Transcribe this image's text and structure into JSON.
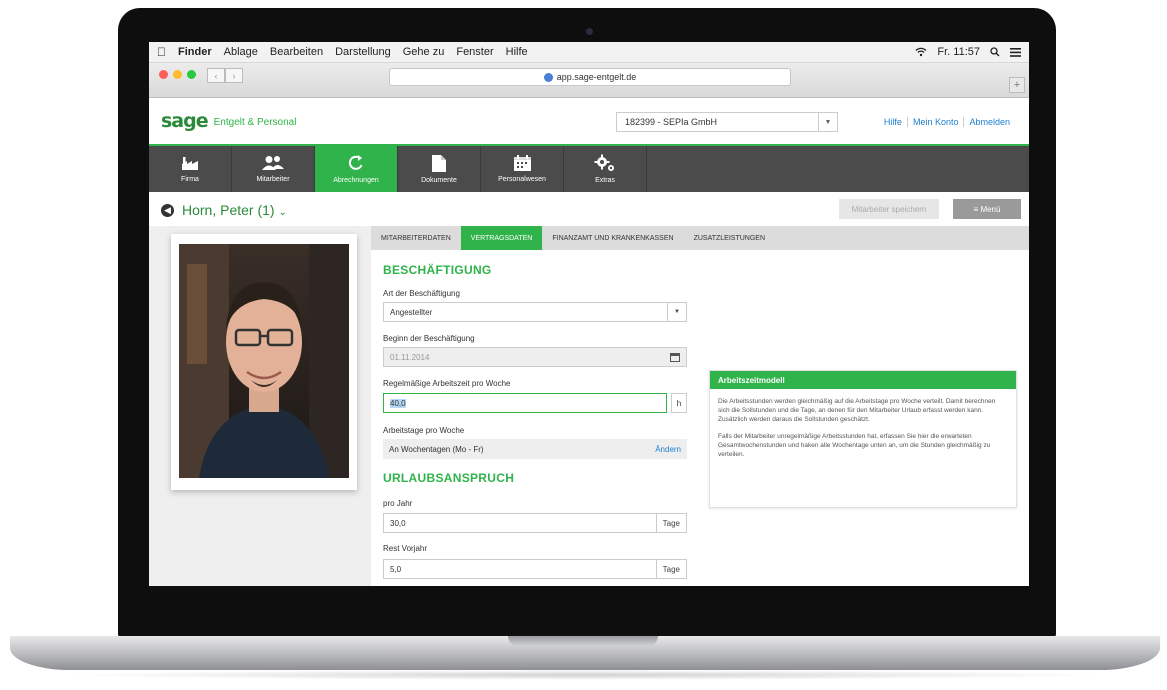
{
  "menubar": {
    "items": [
      "Finder",
      "Ablage",
      "Bearbeiten",
      "Darstellung",
      "Gehe zu",
      "Fenster",
      "Hilfe"
    ],
    "clock": "Fr. 11:57"
  },
  "browser": {
    "url": "app.sage-entgelt.de"
  },
  "header": {
    "logo": "sage",
    "product": "Entgelt & Personal",
    "company": "182399 - SEPIa GmbH",
    "links": [
      "Hilfe",
      "Mein Konto",
      "Abmelden"
    ]
  },
  "nav": {
    "tiles": [
      {
        "label": "Firma",
        "icon": "factory-icon"
      },
      {
        "label": "Mitarbeiter",
        "icon": "people-icon"
      },
      {
        "label": "Abrechnungen",
        "icon": "refresh-icon",
        "active": true
      },
      {
        "label": "Dokumente",
        "icon": "document-icon"
      },
      {
        "label": "Personalwesen",
        "icon": "calendar-icon"
      },
      {
        "label": "Extras",
        "icon": "gears-icon"
      }
    ]
  },
  "titlebar": {
    "name": "Horn, Peter (1)",
    "save": "Mitarbeiter speichern",
    "menu": "≡ Menü"
  },
  "tabs": [
    "MITARBEITERDATEN",
    "VERTRAGSDATEN",
    "FINANZAMT UND KRANKENKASSEN",
    "ZUSATZLEISTUNGEN"
  ],
  "form": {
    "section1": "BESCHÄFTIGUNG",
    "art_label": "Art der Beschäftigung",
    "art_value": "Angestellter",
    "beginn_label": "Beginn der Beschäftigung",
    "beginn_value": "01.11.2014",
    "arbeitszeit_label": "Regelmäßige Arbeitszeit pro Woche",
    "arbeitszeit_value": "40,0",
    "arbeitszeit_unit": "h",
    "tage_label": "Arbeitstage pro Woche",
    "tage_value": "An Wochentagen (Mo - Fr)",
    "tage_action": "Ändern",
    "section2": "URLAUBSANSPRUCH",
    "jahr_label": "pro Jahr",
    "jahr_value": "30,0",
    "jahr_unit": "Tage",
    "rest_label": "Rest Vorjahr",
    "rest_value": "5,0",
    "rest_unit": "Tage"
  },
  "tooltip": {
    "title": "Arbeitszeitmodell",
    "p1": "Die Arbeitsstunden werden gleichmäßig auf die Arbeitstage pro Woche verteilt. Damit berechnen sich die Sollstunden und die Tage, an denen für den Mitarbeiter Urlaub erfasst werden kann. Zusätzlich werden daraus die Sollstunden geschätzt.",
    "p2": "Falls der Mitarbeiter unregelmäßige Arbeitsstunden hat, erfassen Sie hier die erwarteten Gesamtwochenstunden und haken alle Wochentage unten an, um die Stunden gleichmäßig zu verteilen."
  },
  "colors": {
    "accent": "#2fb34a",
    "nav_bg": "#4b4b4b",
    "link": "#1f7fd0"
  }
}
